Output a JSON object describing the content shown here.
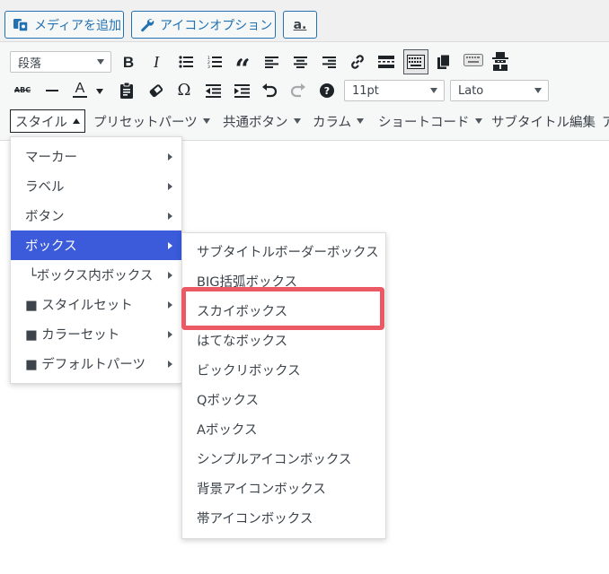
{
  "media_buttons": {
    "add_media_label": "メディアを追加",
    "icon_option_label": "アイコンオプション",
    "amazon_label": "a."
  },
  "toolbar": {
    "format_select": "段落",
    "font_size_select": "11pt",
    "font_family_select": "Lato",
    "icons_row1": [
      "bold-icon",
      "italic-icon",
      "bullet-list-icon",
      "numbered-list-icon",
      "blockquote-icon",
      "align-left-icon",
      "align-center-icon",
      "align-right-icon",
      "link-icon",
      "read-more-icon",
      "toolbar-toggle-icon",
      "copy-icon",
      "keyboard-icon",
      "agent-icon"
    ],
    "icons_row2": [
      "strikethrough-icon",
      "horizontal-line-icon",
      "text-color-icon",
      "paste-text-icon",
      "clear-formatting-icon",
      "special-character-icon",
      "outdent-icon",
      "indent-icon",
      "undo-icon",
      "redo-icon",
      "help-icon"
    ],
    "bold_glyph": "B",
    "italic_glyph": "I",
    "quote_glyph": "“",
    "omega_glyph": "Ω",
    "text_color_glyph": "A",
    "help_glyph": "?",
    "strike_glyph": "ABC"
  },
  "menubar": {
    "style": "スタイル",
    "preset_parts": "プリセットパーツ",
    "common_button": "共通ボタン",
    "column": "カラム",
    "shortcode": "ショートコード",
    "subtitle_edit": "サブタイトル編集",
    "overflow": "ア"
  },
  "style_menu": {
    "items": [
      {
        "label": "マーカー"
      },
      {
        "label": "ラベル"
      },
      {
        "label": "ボタン"
      },
      {
        "label": "ボックス"
      },
      {
        "label": "└ボックス内ボックス"
      },
      {
        "label": "■ スタイルセット"
      },
      {
        "label": "■ カラーセット"
      },
      {
        "label": "■ デフォルトパーツ"
      }
    ],
    "selected_index": 3
  },
  "box_submenu": {
    "items": [
      {
        "label": "サブタイトルボーダーボックス"
      },
      {
        "label": "BIG括弧ボックス"
      },
      {
        "label": "スカイボックス"
      },
      {
        "label": "はてなボックス"
      },
      {
        "label": "ビックリボックス"
      },
      {
        "label": "Qボックス"
      },
      {
        "label": "Aボックス"
      },
      {
        "label": "シンプルアイコンボックス"
      },
      {
        "label": "背景アイコンボックス"
      },
      {
        "label": "帯アイコンボックス"
      }
    ]
  },
  "colors": {
    "selected_bg": "#3b5bdb",
    "highlight_border": "#eb5a64",
    "wp_blue": "#2271b1"
  }
}
